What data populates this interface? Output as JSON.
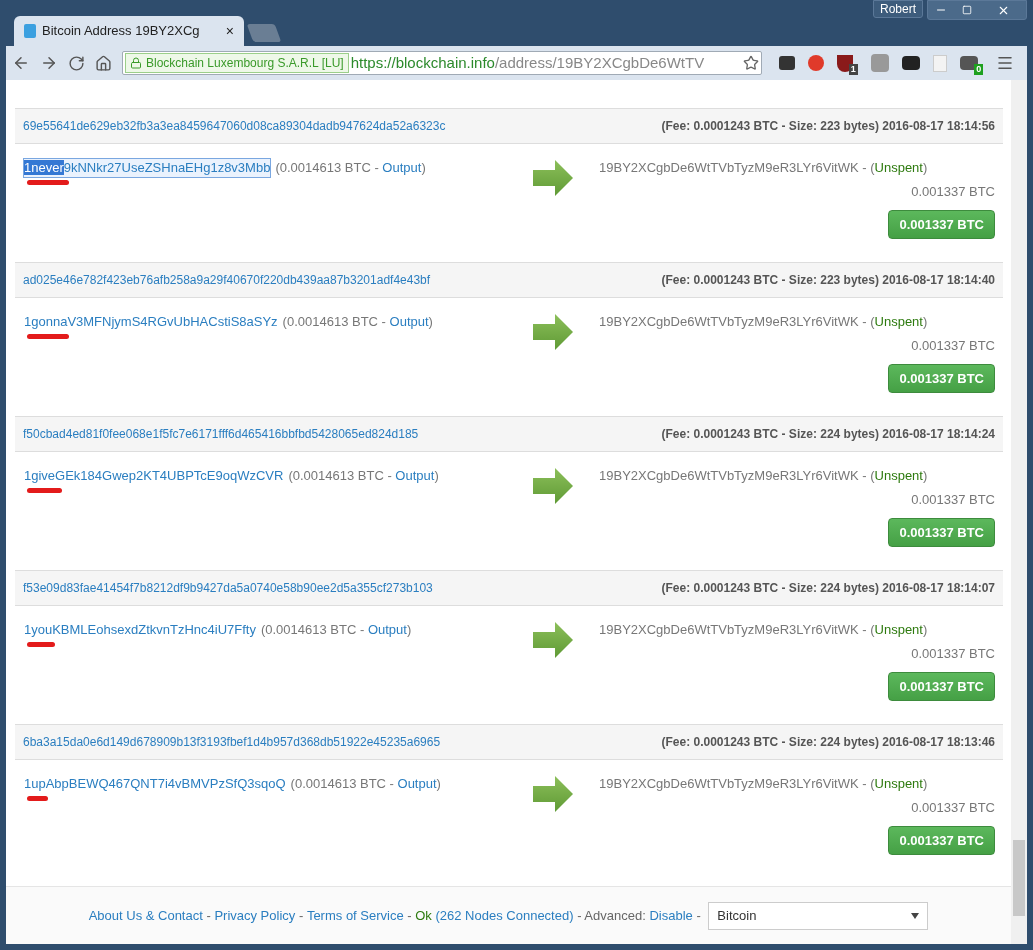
{
  "window": {
    "user": "Robert"
  },
  "tabs": [
    {
      "title": "Bitcoin Address 19BY2XCg",
      "close": "×",
      "selected": true
    }
  ],
  "address_bar": {
    "identity": "Blockchain Luxembourg S.A.R.L [LU]",
    "url_host": "https://blockchain.info",
    "url_path": "/address/19BY2XCgbDe6WtTV"
  },
  "extension_badges": {
    "blocker": "1",
    "badger": "0"
  },
  "status_wrap": {
    "open": " - (",
    "close": ")"
  },
  "transactions": [
    {
      "hash": "69e55641de629eb32fb3a3ea8459647060d08ca89304dadb947624da52a6323c",
      "meta": "(Fee: 0.0001243 BTC - Size: 223 bytes) 2016-08-17 18:14:56",
      "from_prefix": "1never",
      "from_rest": "9kNNkr27UseZSHnaEHg1z8v3Mbb",
      "selected": true,
      "from_amount": "(0.0014613 BTC - ",
      "output_link": "Output",
      "close_paren": ")",
      "to_address": "19BY2XCgbDe6WtTVbTyzM9eR3LYr6VitWK",
      "status": "Unspent",
      "to_amount": "0.001337 BTC",
      "total": "0.001337 BTC"
    },
    {
      "hash": "ad025e46e782f423eb76afb258a9a29f40670f220db439aa87b3201adf4e43bf",
      "meta": "(Fee: 0.0001243 BTC - Size: 223 bytes) 2016-08-17 18:14:40",
      "from_prefix": "1gonna",
      "from_rest": "V3MFNjymS4RGvUbHACstiS8aSYz",
      "selected": false,
      "from_amount": "(0.0014613 BTC - ",
      "output_link": "Output",
      "close_paren": ")",
      "to_address": "19BY2XCgbDe6WtTVbTyzM9eR3LYr6VitWK",
      "status": "Unspent",
      "to_amount": "0.001337 BTC",
      "total": "0.001337 BTC"
    },
    {
      "hash": "f50cbad4ed81f0fee068e1f5fc7e6171fff6d465416bbfbd5428065ed824d185",
      "meta": "(Fee: 0.0001243 BTC - Size: 224 bytes) 2016-08-17 18:14:24",
      "from_prefix": "1give",
      "from_rest": "GEk184Gwep2KT4UBPTcE9oqWzCVR",
      "selected": false,
      "from_amount": "(0.0014613 BTC - ",
      "output_link": "Output",
      "close_paren": ")",
      "to_address": "19BY2XCgbDe6WtTVbTyzM9eR3LYr6VitWK",
      "status": "Unspent",
      "to_amount": "0.001337 BTC",
      "total": "0.001337 BTC"
    },
    {
      "hash": "f53e09d83fae41454f7b8212df9b9427da5a0740e58b90ee2d5a355cf273b103",
      "meta": "(Fee: 0.0001243 BTC - Size: 224 bytes) 2016-08-17 18:14:07",
      "from_prefix": "1you",
      "from_rest": "KBMLEohsexdZtkvnTzHnc4iU7Ffty",
      "selected": false,
      "from_amount": "(0.0014613 BTC - ",
      "output_link": "Output",
      "close_paren": ")",
      "to_address": "19BY2XCgbDe6WtTVbTyzM9eR3LYr6VitWK",
      "status": "Unspent",
      "to_amount": "0.001337 BTC",
      "total": "0.001337 BTC"
    },
    {
      "hash": "6ba3a15da0e6d149d678909b13f3193fbef1d4b957d368db51922e45235a6965",
      "meta": "(Fee: 0.0001243 BTC - Size: 224 bytes) 2016-08-17 18:13:46",
      "from_prefix": "1up",
      "from_rest": "AbpBEWQ467QNT7i4vBMVPzSfQ3sqoQ",
      "selected": false,
      "from_amount": "(0.0014613 BTC - ",
      "output_link": "Output",
      "close_paren": ")",
      "to_address": "19BY2XCgbDe6WtTVbTyzM9eR3LYr6VitWK",
      "status": "Unspent",
      "to_amount": "0.001337 BTC",
      "total": "0.001337 BTC"
    }
  ],
  "footer": {
    "links": [
      {
        "kind": "link",
        "text": "About Us & Contact"
      },
      {
        "kind": "sep",
        "text": " - "
      },
      {
        "kind": "link",
        "text": "Privacy Policy"
      },
      {
        "kind": "sep",
        "text": " - "
      },
      {
        "kind": "link",
        "text": "Terms of Service"
      },
      {
        "kind": "sep",
        "text": " - "
      },
      {
        "kind": "ok",
        "text": "Ok"
      },
      {
        "kind": "link",
        "text": " (262 Nodes Connected)"
      },
      {
        "kind": "sep",
        "text": " - Advanced: "
      },
      {
        "kind": "link",
        "text": "Disable"
      },
      {
        "kind": "sep",
        "text": " - "
      }
    ],
    "currency": "Bitcoin"
  }
}
